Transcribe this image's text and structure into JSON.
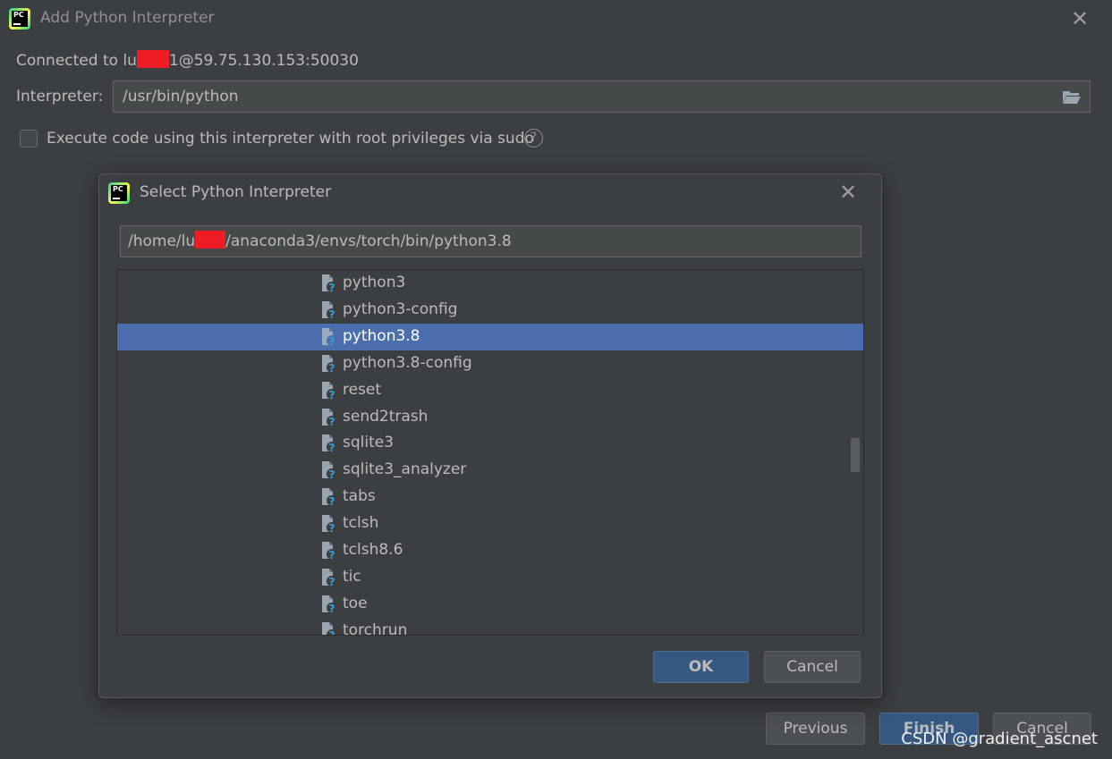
{
  "outer_dialog": {
    "title": "Add Python Interpreter",
    "logo_text": "PC",
    "connection_prefix": "Connected to lu",
    "connection_suffix": "1@59.75.130.153:50030",
    "interpreter_label": "Interpreter:",
    "interpreter_value": "/usr/bin/python",
    "sudo_checkbox_label": "Execute code using this interpreter with root privileges via sudo",
    "sudo_checked": false,
    "buttons": {
      "previous": "Previous",
      "finish": "Finish",
      "cancel": "Cancel"
    }
  },
  "select_dialog": {
    "title": "Select Python Interpreter",
    "logo_text": "PC",
    "path_prefix": "/home/lu",
    "path_suffix": "/anaconda3/envs/torch/bin/python3.8",
    "files": [
      {
        "name": "python3",
        "icon": "unknown-file-icon",
        "selected": false
      },
      {
        "name": "python3-config",
        "icon": "unknown-file-icon",
        "selected": false
      },
      {
        "name": "python3.8",
        "icon": "unknown-file-icon",
        "selected": true
      },
      {
        "name": "python3.8-config",
        "icon": "unknown-file-icon",
        "selected": false
      },
      {
        "name": "reset",
        "icon": "unknown-file-icon",
        "selected": false
      },
      {
        "name": "send2trash",
        "icon": "unknown-file-icon",
        "selected": false
      },
      {
        "name": "sqlite3",
        "icon": "unknown-file-icon",
        "selected": false
      },
      {
        "name": "sqlite3_analyzer",
        "icon": "unknown-file-icon",
        "selected": false
      },
      {
        "name": "tabs",
        "icon": "unknown-file-icon",
        "selected": false
      },
      {
        "name": "tclsh",
        "icon": "unknown-file-icon",
        "selected": false
      },
      {
        "name": "tclsh8.6",
        "icon": "unknown-file-icon",
        "selected": false
      },
      {
        "name": "tic",
        "icon": "unknown-file-icon",
        "selected": false
      },
      {
        "name": "toe",
        "icon": "unknown-file-icon",
        "selected": false
      },
      {
        "name": "torchrun",
        "icon": "unknown-file-icon",
        "selected": false
      }
    ],
    "buttons": {
      "ok": "OK",
      "cancel": "Cancel"
    }
  },
  "watermark": "CSDN @gradient_ascnet",
  "colors": {
    "background": "#3c3f41",
    "selection": "#4b6eaf",
    "default_button": "#365880",
    "redaction": "#ee1c24"
  }
}
